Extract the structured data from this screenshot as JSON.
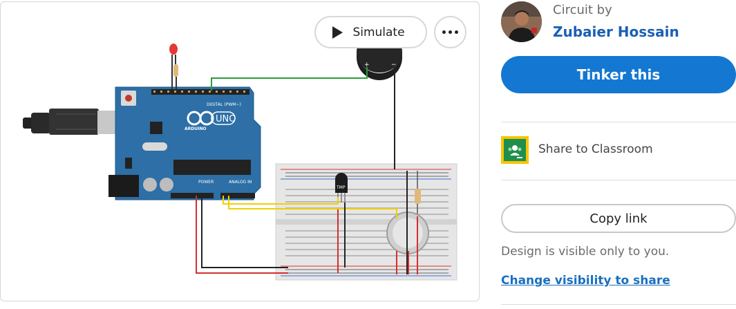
{
  "toolbar": {
    "simulate_label": "Simulate",
    "more_icon": "more-horizontal-icon"
  },
  "circuit": {
    "board_name": "UNO",
    "board_brand": "ARDUINO",
    "header_digital": "DIGITAL (PWM~)",
    "header_power": "POWER",
    "header_analog": "ANALOG IN",
    "sensor_label": "TMP",
    "buzzer_plus": "+",
    "buzzer_minus": "−"
  },
  "author": {
    "by_label": "Circuit by",
    "name": "Zubaier Hossain"
  },
  "actions": {
    "tinker_label": "Tinker this",
    "classroom_label": "Share to Classroom",
    "copy_link_label": "Copy link",
    "visibility_note": "Design is visible only to you.",
    "visibility_link": "Change visibility to share"
  },
  "colors": {
    "primary": "#1477d2",
    "link": "#1a5fb4",
    "board": "#2d6fa6"
  }
}
